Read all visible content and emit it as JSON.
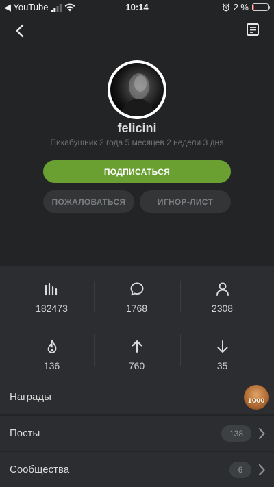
{
  "status_bar": {
    "carrier": "◀ YouTube",
    "time": "10:14",
    "battery_text": "2 %",
    "battery_level": 0.02
  },
  "profile": {
    "username": "felicini",
    "tenure": "Пикабушник 2 года 5 месяцев 2 недели 3 дня"
  },
  "actions": {
    "subscribe": "ПОДПИСАТЬСЯ",
    "report": "ПОЖАЛОВАТЬСЯ",
    "ignore": "ИГНОР-ЛИСТ"
  },
  "stats": {
    "rating": "182473",
    "comments": "1768",
    "subscribers": "2308",
    "hot": "136",
    "pluses": "760",
    "minuses": "35"
  },
  "list": {
    "awards_label": "Награды",
    "award_badge_text": "1000",
    "posts_label": "Посты",
    "posts_count": "138",
    "communities_label": "Сообщества",
    "communities_count": "6"
  },
  "colors": {
    "background": "#222426",
    "panel": "#2b2d30",
    "accent_green": "#6aa032",
    "battery_red": "#ee3333"
  }
}
